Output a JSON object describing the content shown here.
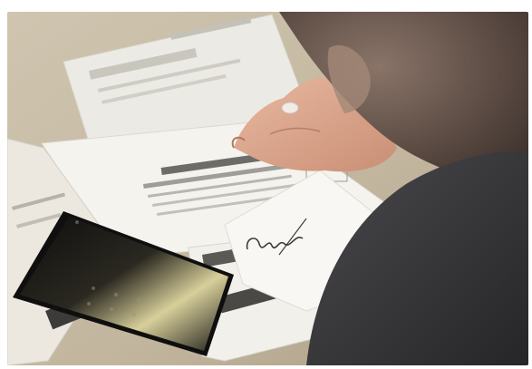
{
  "photo": {
    "handwritten_note": "Contas",
    "colors": {
      "table": "#cbbfa8",
      "paper": "#f3f1ec",
      "phone": "#141414",
      "skin": "#d9a48c",
      "shirt": "#3a3a3c"
    }
  }
}
